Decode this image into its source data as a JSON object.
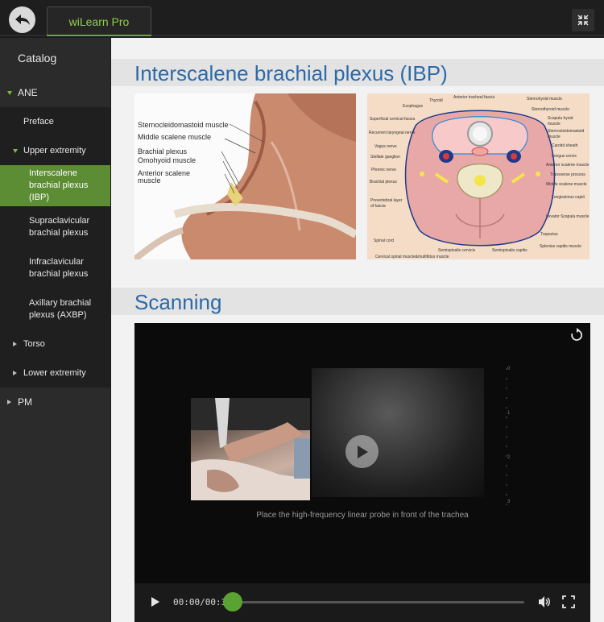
{
  "app": {
    "tab_label": "wiLearn Pro"
  },
  "sidebar": {
    "title": "Catalog",
    "items": [
      {
        "label": "ANE",
        "caret": "down"
      },
      {
        "label": "Preface"
      },
      {
        "label": "Upper extremity",
        "caret": "down"
      },
      {
        "label": "Interscalene brachial plexus (IBP)",
        "active": true
      },
      {
        "label": "Supraclavicular brachial plexus"
      },
      {
        "label": "Infraclavicular brachial plexus"
      },
      {
        "label": "Axillary brachial plexus (AXBP)"
      },
      {
        "label": "Torso",
        "caret": "right"
      },
      {
        "label": "Lower extremity",
        "caret": "right"
      },
      {
        "label": "PM",
        "caret": "right"
      }
    ]
  },
  "main": {
    "section1_title": "Interscalene brachial plexus (IBP)",
    "section2_title": "Scanning",
    "figure_left_labels": [
      "Sternocleidomastoid muscle",
      "Middle scalene muscle",
      "Brachial plexus",
      "Omohyoid muscle",
      "Anterior scalene",
      "muscle"
    ],
    "figure_right_labels": [
      "Thyroid",
      "Anterior tracheal fascia",
      "Sternohyoid muscle",
      "Esophagus",
      "Sternothyroid muscle",
      "Superficial cervical fascia",
      "Scapula hyoid",
      "muscle",
      "Recurrent laryngeal nerve",
      "Sternocleidomastoid",
      "muscle",
      "Vagus nerve",
      "Carotid sheath",
      "Stellate ganglion",
      "Longus cervix",
      "Anterior scalene muscle",
      "Phrenic nerve",
      "Transverse process",
      "Brachial plexus",
      "Middle scalene muscle",
      "Prevertebral layer",
      "of fascia",
      "Longissimus capiti",
      "Levator Scapula muscle",
      "Trapezius",
      "Spinal cord",
      "Splenius capitis muscle",
      "Semispinalis cervicis",
      "Semispinalis capitis",
      "Cervical spinal muscle&multifidus muscle"
    ],
    "video": {
      "caption": "Place the high-frequency linear probe in front of the trachea",
      "time": "00:00/00:30",
      "progress": 0,
      "depth_ticks": [
        "0",
        "1",
        "2",
        "3"
      ]
    }
  }
}
